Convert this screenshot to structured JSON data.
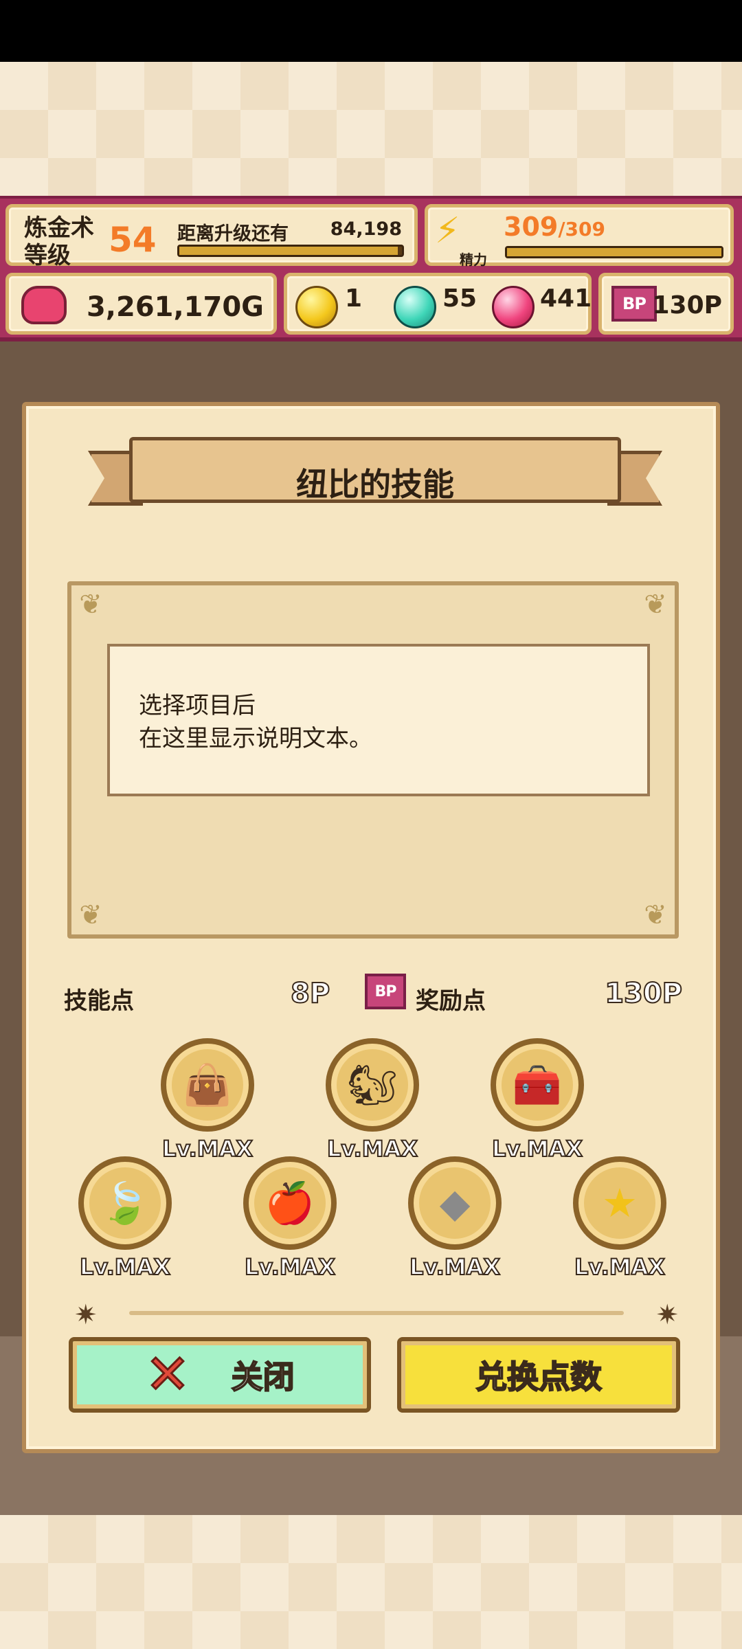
{
  "hud": {
    "alchemy_label": "炼金术\n等级",
    "alchemy_level": "54",
    "next_label": "距离升级还有",
    "next_value": "84,198",
    "exp_progress": 0.98,
    "energy_value": "309",
    "energy_max": "/309",
    "energy_label": "精力",
    "energy_progress": 1.0,
    "gold": "3,261,170G",
    "gem_yellow": "1",
    "gem_cyan": "55",
    "gem_pink": "441",
    "bp_badge": "BP",
    "bp_value": "130P"
  },
  "panel": {
    "title": "纽比的技能",
    "description_line1": "选择项目后",
    "description_line2": "在这里显示说明文本。",
    "skill_points_label": "技能点",
    "skill_points_value": "8P",
    "bonus_badge": "BP",
    "bonus_points_label": "奖励点",
    "bonus_points_value": "130P"
  },
  "skills": [
    {
      "icon": "bag-icon",
      "level": "Lv.MAX"
    },
    {
      "icon": "squirrel-icon",
      "level": "Lv.MAX"
    },
    {
      "icon": "treasure-chest-icon",
      "level": "Lv.MAX"
    },
    {
      "icon": "leaf-icon",
      "level": "Lv.MAX"
    },
    {
      "icon": "fruit-icon",
      "level": "Lv.MAX"
    },
    {
      "icon": "ore-icon",
      "level": "Lv.MAX"
    },
    {
      "icon": "star-icon",
      "level": "Lv.MAX"
    }
  ],
  "buttons": {
    "close_label": "关闭",
    "exchange_label": "兑换点数"
  },
  "colors": {
    "hud_bg": "#a8325e",
    "accent_orange": "#f37b28",
    "close_button": "#a6f2c8",
    "exchange_button": "#f7e03c"
  }
}
